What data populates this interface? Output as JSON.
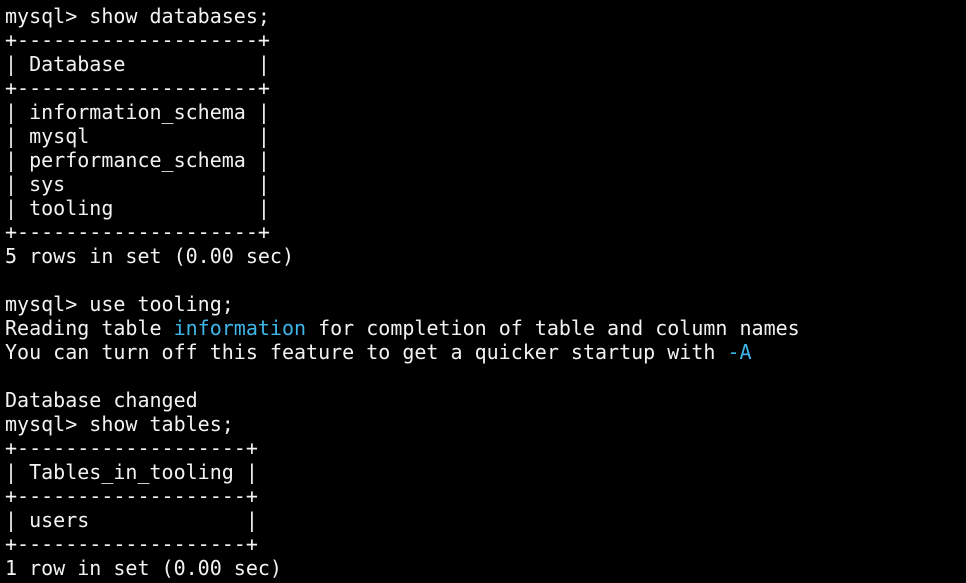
{
  "terminal": {
    "highlight_color": "#3fb6e8",
    "text_color": "#f2f2f2",
    "background_color": "#000000",
    "lines": [
      [
        {
          "text": "mysql> show databases;"
        }
      ],
      [
        {
          "text": "+--------------------+"
        }
      ],
      [
        {
          "text": "| Database           |"
        }
      ],
      [
        {
          "text": "+--------------------+"
        }
      ],
      [
        {
          "text": "| information_schema |"
        }
      ],
      [
        {
          "text": "| mysql              |"
        }
      ],
      [
        {
          "text": "| performance_schema |"
        }
      ],
      [
        {
          "text": "| sys                |"
        }
      ],
      [
        {
          "text": "| tooling            |"
        }
      ],
      [
        {
          "text": "+--------------------+"
        }
      ],
      [
        {
          "text": "5 rows in set (0.00 sec)"
        }
      ],
      [
        {
          "text": ""
        }
      ],
      [
        {
          "text": "mysql> use tooling;"
        }
      ],
      [
        {
          "text": "Reading table "
        },
        {
          "text": "information",
          "hl": true
        },
        {
          "text": " for completion of table and column names"
        }
      ],
      [
        {
          "text": "You can turn off this feature to get a quicker startup with "
        },
        {
          "text": "-A",
          "hl": true
        }
      ],
      [
        {
          "text": ""
        }
      ],
      [
        {
          "text": "Database changed"
        }
      ],
      [
        {
          "text": "mysql> show tables;"
        }
      ],
      [
        {
          "text": "+-------------------+"
        }
      ],
      [
        {
          "text": "| Tables_in_tooling |"
        }
      ],
      [
        {
          "text": "+-------------------+"
        }
      ],
      [
        {
          "text": "| users             |"
        }
      ],
      [
        {
          "text": "+-------------------+"
        }
      ],
      [
        {
          "text": "1 row in set (0.00 sec)"
        }
      ]
    ]
  }
}
